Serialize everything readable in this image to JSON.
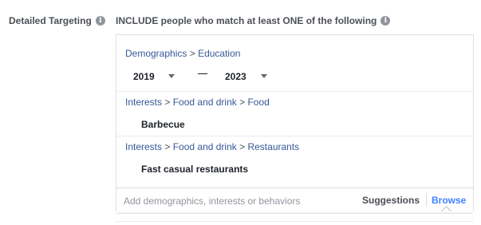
{
  "targeting": {
    "label": "Detailed Targeting",
    "info_icon": "info-icon",
    "include_text": "INCLUDE people who match at least ONE of the following"
  },
  "education": {
    "crumb": [
      "Demographics",
      "Education"
    ],
    "from_year": "2019",
    "to_year": "2023",
    "dash": "—"
  },
  "items": [
    {
      "crumb": [
        "Interests",
        "Food and drink",
        "Food"
      ],
      "name": "Barbecue"
    },
    {
      "crumb": [
        "Interests",
        "Food and drink",
        "Restaurants"
      ],
      "name": "Fast casual restaurants"
    }
  ],
  "search": {
    "placeholder": "Add demographics, interests or behaviors",
    "suggestions_label": "Suggestions",
    "browse_label": "Browse"
  },
  "colors": {
    "link": "#365899",
    "accent": "#4080ff",
    "muted": "#90949c"
  }
}
